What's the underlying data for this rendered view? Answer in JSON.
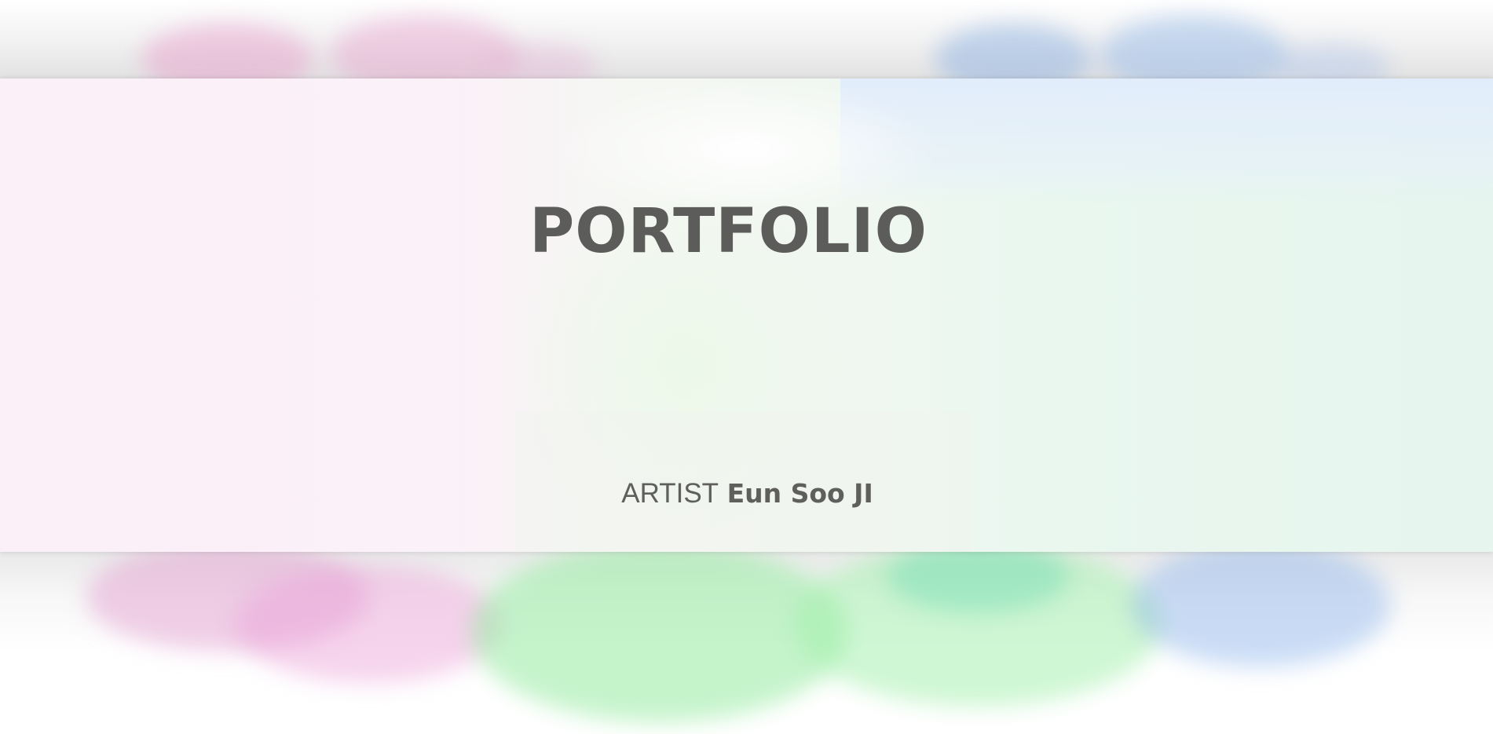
{
  "hero": {
    "title": "PORTFOLIO",
    "subtitle_role": "ARTIST",
    "subtitle_name": "Eun Soo JI"
  },
  "colors": {
    "text": "#5c5d5a",
    "pink_wash": "#fcf0f8",
    "green_wash": "#e6f5ee",
    "blue_wash": "#e1ecfc"
  }
}
